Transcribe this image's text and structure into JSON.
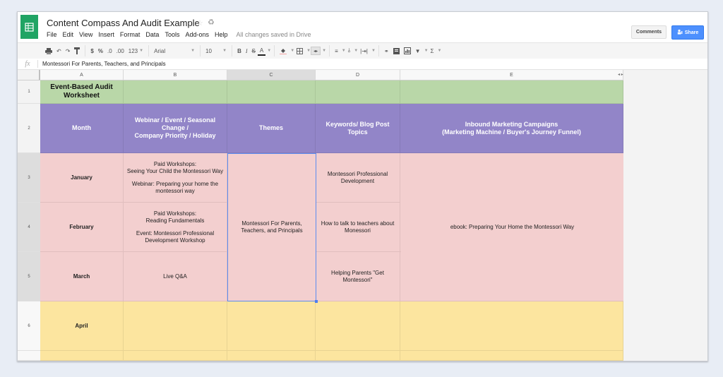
{
  "app": {
    "title": "Content Compass And Audit Example",
    "save_status": "All changes saved in Drive",
    "menu": [
      "File",
      "Edit",
      "View",
      "Insert",
      "Format",
      "Data",
      "Tools",
      "Add-ons",
      "Help"
    ],
    "comments_label": "Comments",
    "share_label": "Share"
  },
  "toolbar": {
    "currency": "$",
    "percent": "%",
    "decrease_decimals": ".0",
    "increase_decimals": ".00",
    "more_formats": "123",
    "font": "Arial",
    "font_size": "10",
    "bold": "B",
    "italic": "I",
    "strikethrough": "S",
    "text_color": "A",
    "functions": "Σ"
  },
  "formula_bar": {
    "fx": "fx",
    "value": "Montessori For Parents, Teachers, and Principals"
  },
  "columns": [
    "A",
    "B",
    "C",
    "D",
    "E"
  ],
  "row_numbers": [
    "1",
    "2",
    "3",
    "4",
    "5",
    "6"
  ],
  "sheet": {
    "title": "Event-Based Audit Worksheet",
    "headers": {
      "month": "Month",
      "events": "Webinar / Event / Seasonal Change / Company Priority / Holiday",
      "themes": "Themes",
      "keywords": "Keywords/ Blog Post Topics",
      "campaigns": "Inbound Marketing Campaigns (Marketing Machine / Buyer's Journey Funnel)"
    },
    "header_lines": {
      "events": [
        "Webinar / Event / Seasonal",
        "Change /",
        "Company Priority / Holiday"
      ],
      "keywords": [
        "Keywords/ Blog Post",
        "Topics"
      ],
      "campaigns": [
        "Inbound Marketing Campaigns",
        "(Marketing Machine / Buyer's Journey Funnel)"
      ]
    },
    "rows": [
      {
        "month": "January",
        "events": [
          "Paid Workshops:\nSeeing Your Child the Montessori Way",
          "Webinar: Preparing your home the montessori way"
        ],
        "keywords": "Montessori Professional Development"
      },
      {
        "month": "February",
        "events": [
          "Paid Workshops:\nReading Fundamentals",
          "Event: Montessori Professional Development Workshop"
        ],
        "keywords": "How to talk to teachers about Monessori"
      },
      {
        "month": "March",
        "events": [
          "Live Q&A"
        ],
        "keywords": "Helping Parents \"Get Montessori\""
      },
      {
        "month": "April",
        "events": [],
        "keywords": ""
      }
    ],
    "merged_theme": "Montessori For Parents, Teachers, and Principals",
    "merged_campaign": "ebook: Preparing Your Home the Montessori Way"
  },
  "colors": {
    "title_row": "#b9d7a8",
    "header_row": "#9285c8",
    "q1_rows": "#f3cfcf",
    "q2_rows": "#fce59f",
    "share_button": "#4d90fe",
    "sheets_logo": "#20a464"
  }
}
